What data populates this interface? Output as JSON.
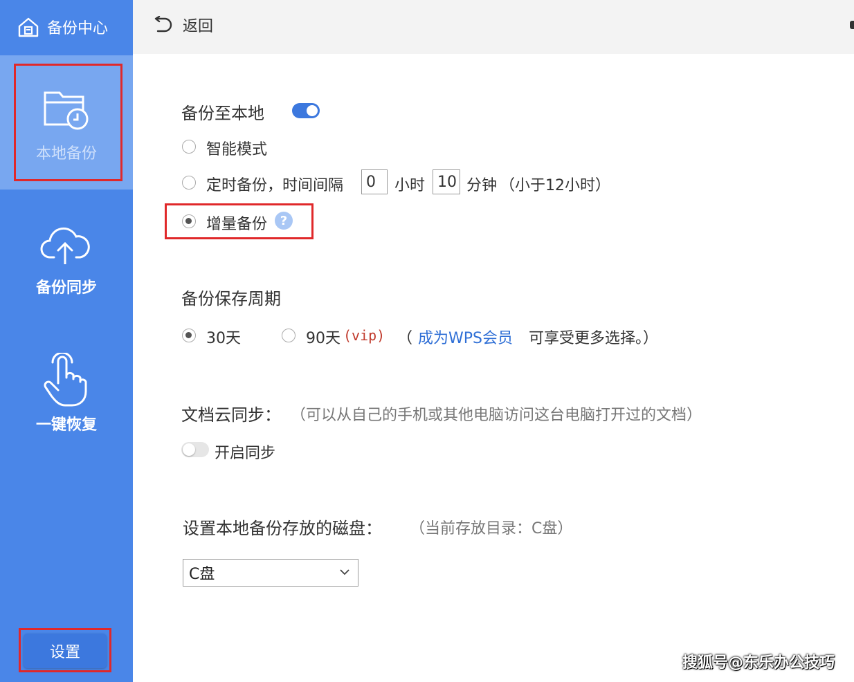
{
  "sidebar": {
    "brand_title": "备份中心",
    "items": [
      {
        "label": "本地备份"
      },
      {
        "label": "备份同步"
      },
      {
        "label": "一键恢复"
      }
    ],
    "settings_label": "设置"
  },
  "topbar": {
    "back_label": "返回"
  },
  "local_backup": {
    "title": "备份至本地",
    "enabled": true,
    "modes": {
      "smart": "智能模式",
      "timed": "定时备份，时间间隔",
      "hours_value": "0",
      "hours_unit": "小时",
      "minutes_value": "10",
      "minutes_unit": "分钟",
      "limit_note": "（小于12小时）",
      "incremental": "增量备份",
      "help_mark": "?"
    },
    "selected_mode": "incremental"
  },
  "retention": {
    "title": "备份保存周期",
    "option_30": "30天",
    "option_90": "90天",
    "vip_tag": "(vip)",
    "paren_open": "（",
    "member_link": "成为WPS会员",
    "member_text": "可享受更多选择。）",
    "selected": "30天"
  },
  "cloud_sync": {
    "title": "文档云同步：",
    "desc": "（可以从自己的手机或其他电脑访问这台电脑打开过的文档）",
    "toggle_label": "开启同步",
    "enabled": false
  },
  "disk": {
    "title": "设置本地备份存放的磁盘：",
    "current": "（当前存放目录：C盘）",
    "selected": "C盘"
  },
  "watermark": "搜狐号@东乐办公技巧",
  "colors": {
    "sidebar": "#4a86e8",
    "sidebar_active": "#78a7f0",
    "accent": "#3c78de",
    "highlight_box": "#e0282a",
    "link": "#2f6fd6"
  }
}
